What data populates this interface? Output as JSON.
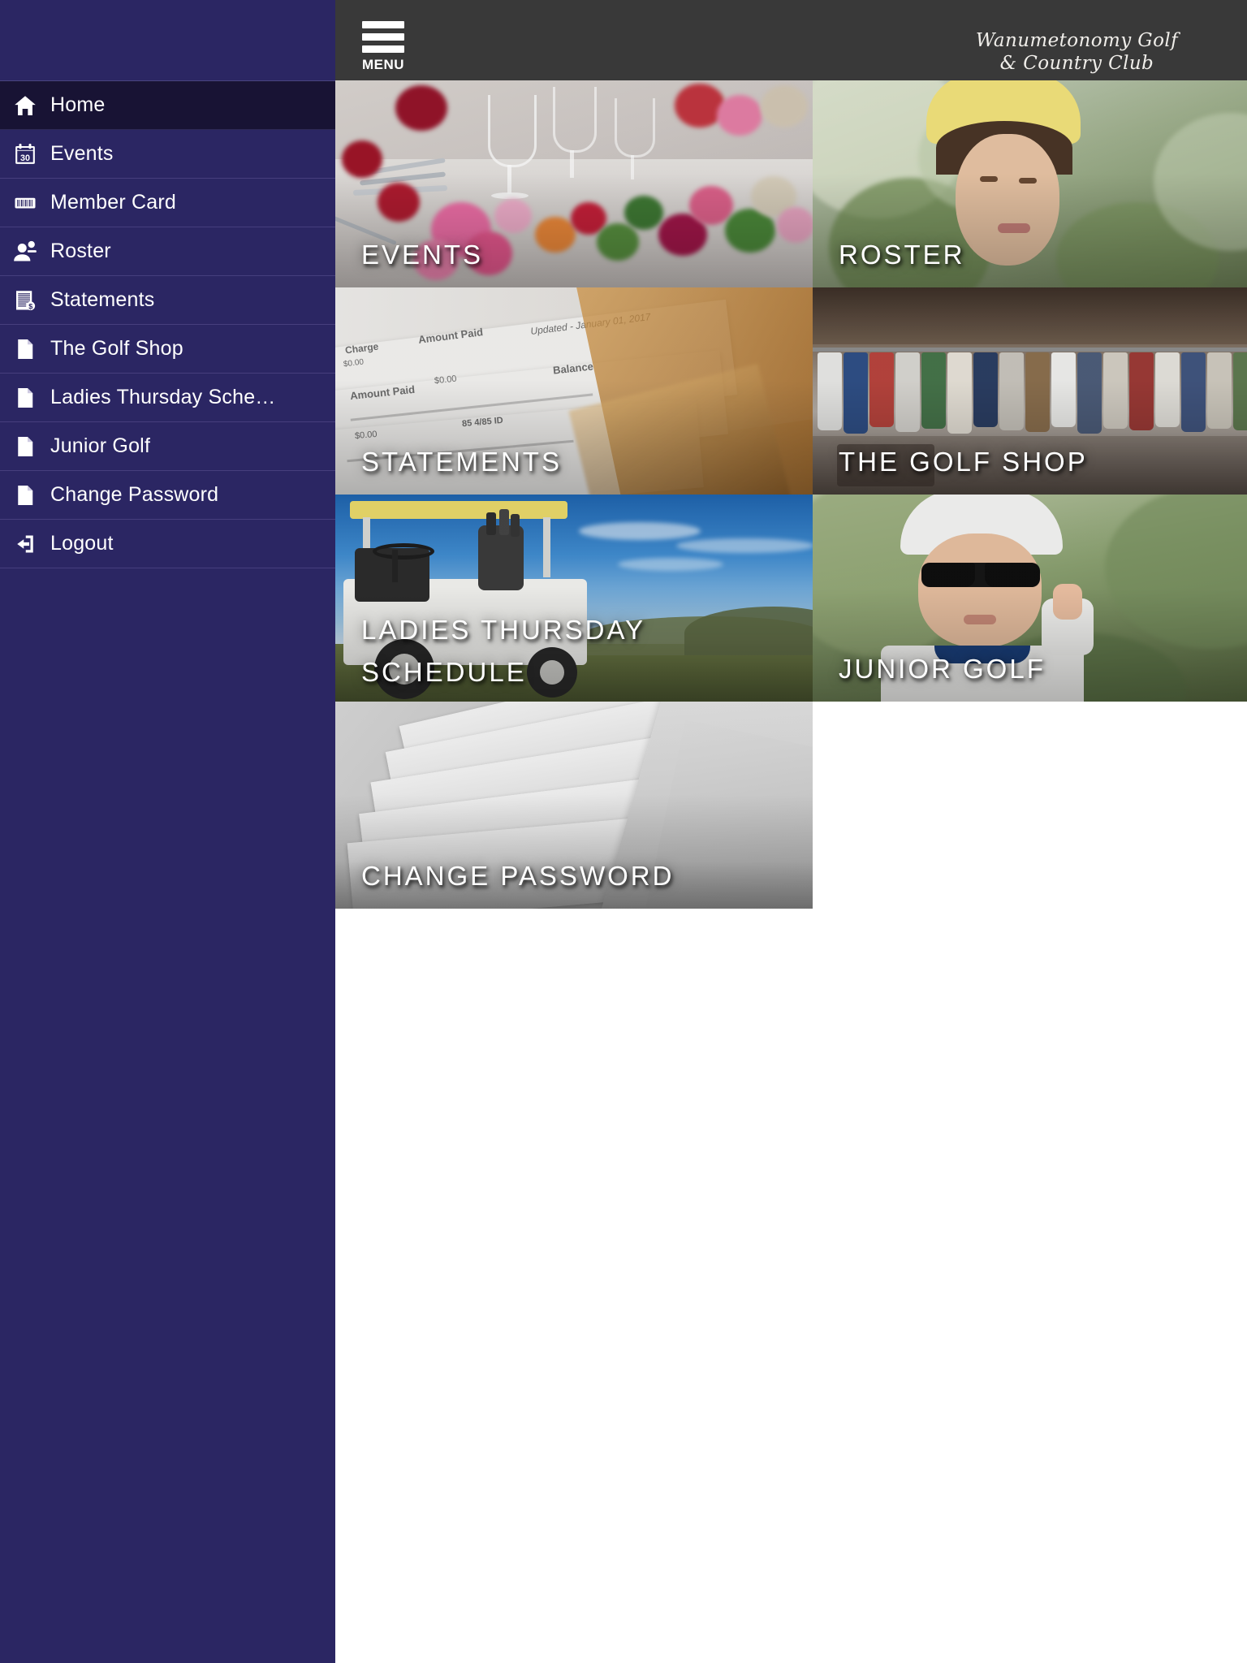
{
  "header": {
    "menu_label": "MENU",
    "menu_icon": "hamburger-icon",
    "logo_line1": "Wanumetonomy Golf",
    "logo_line2": "& Country Club",
    "background_color": "#393939"
  },
  "sidebar": {
    "background_color": "#2b2663",
    "active_background_color": "#181334",
    "items": [
      {
        "label": "Home",
        "icon": "home-icon",
        "active": true
      },
      {
        "label": "Events",
        "icon": "calendar-icon",
        "active": false
      },
      {
        "label": "Member Card",
        "icon": "barcode-icon",
        "active": false
      },
      {
        "label": "Roster",
        "icon": "people-icon",
        "active": false
      },
      {
        "label": "Statements",
        "icon": "invoice-icon",
        "active": false
      },
      {
        "label": "The Golf Shop",
        "icon": "document-icon",
        "active": false
      },
      {
        "label": "Ladies Thursday Sche…",
        "icon": "document-icon",
        "active": false
      },
      {
        "label": "Junior Golf",
        "icon": "document-icon",
        "active": false
      },
      {
        "label": "Change Password",
        "icon": "document-icon",
        "active": false
      },
      {
        "label": "Logout",
        "icon": "logout-icon",
        "active": false
      }
    ]
  },
  "main": {
    "tiles_left": [
      {
        "caption": "EVENTS",
        "art": "events"
      },
      {
        "caption": "STATEMENTS",
        "art": "statements"
      },
      {
        "caption": "LADIES THURSDAY SCHEDULE",
        "art": "ladies"
      },
      {
        "caption": "CHANGE PASSWORD",
        "art": "password"
      }
    ],
    "tiles_right": [
      {
        "caption": "ROSTER",
        "art": "roster"
      },
      {
        "caption": "THE GOLF SHOP",
        "art": "shop"
      },
      {
        "caption": "JUNIOR GOLF",
        "art": "junior"
      }
    ]
  }
}
